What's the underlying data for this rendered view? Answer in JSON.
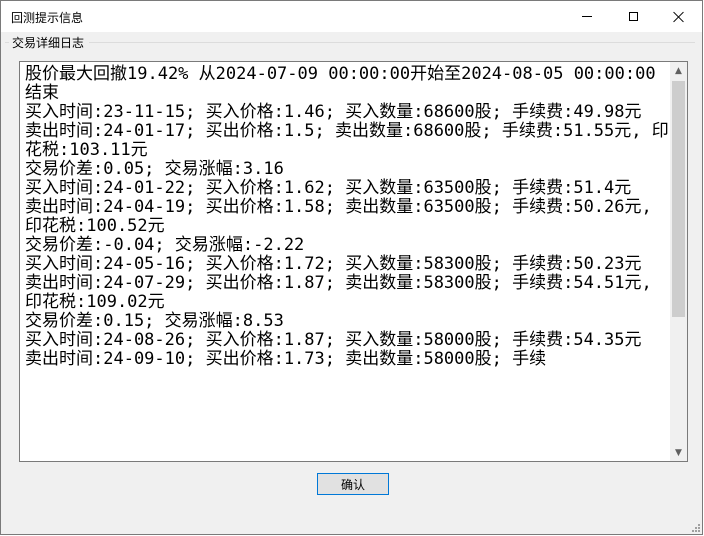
{
  "window": {
    "title": "回测提示信息"
  },
  "group": {
    "label": "交易详细日志"
  },
  "log": {
    "text": "股价最大回撤19.42% 从2024-07-09 00:00:00开始至2024-08-05 00:00:00结束\n买入时间:23-11-15; 买入价格:1.46; 买入数量:68600股; 手续费:49.98元\n卖出时间:24-01-17; 买出价格:1.5; 卖出数量:68600股; 手续费:51.55元, 印花税:103.11元\n交易价差:0.05; 交易涨幅:3.16\n买入时间:24-01-22; 买入价格:1.62; 买入数量:63500股; 手续费:51.4元\n卖出时间:24-04-19; 买出价格:1.58; 卖出数量:63500股; 手续费:50.26元, 印花税:100.52元\n交易价差:-0.04; 交易涨幅:-2.22\n买入时间:24-05-16; 买入价格:1.72; 买入数量:58300股; 手续费:50.23元\n卖出时间:24-07-29; 买出价格:1.87; 卖出数量:58300股; 手续费:54.51元, 印花税:109.02元\n交易价差:0.15; 交易涨幅:8.53\n买入时间:24-08-26; 买入价格:1.87; 买入数量:58000股; 手续费:54.35元\n卖出时间:24-09-10; 买出价格:1.73; 卖出数量:58000股; 手续"
  },
  "buttons": {
    "ok_label": "确认"
  },
  "icons": {
    "minimize": "minimize-icon",
    "maximize": "maximize-icon",
    "close": "close-icon",
    "scroll_up": "scroll-up-arrow-icon",
    "scroll_down": "scroll-down-arrow-icon",
    "resize": "resize-grip-icon"
  },
  "colors": {
    "accent": "#0078d7",
    "window_bg": "#f0f0f0",
    "text": "#000000"
  }
}
